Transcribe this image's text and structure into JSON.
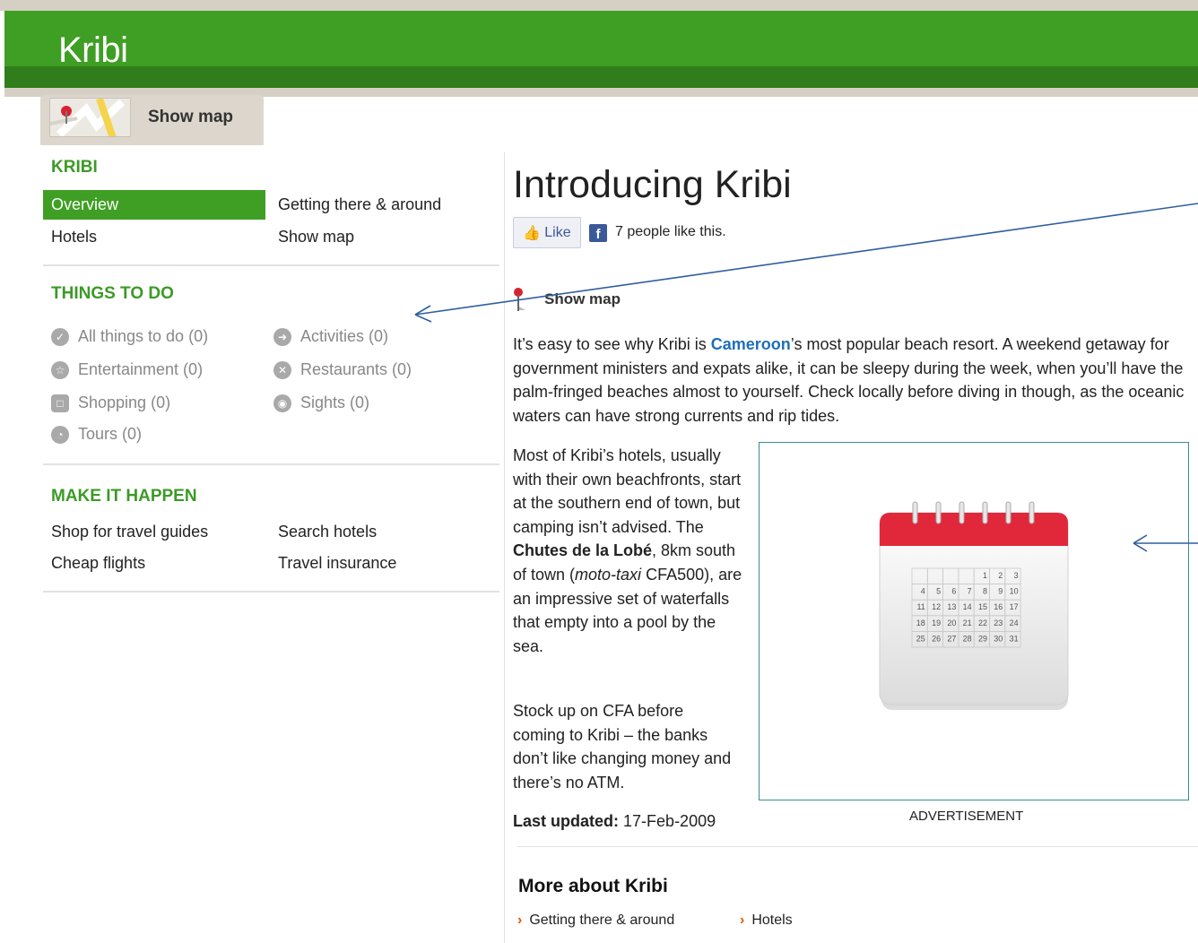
{
  "header": {
    "title": "Kribi"
  },
  "map_tab": {
    "label": "Show map"
  },
  "sidebar": {
    "kribi": {
      "title": "KRIBI",
      "items": [
        "Overview",
        "Getting there & around",
        "Hotels",
        "Show map"
      ]
    },
    "things_to_do": {
      "title": "THINGS TO DO",
      "items": [
        {
          "label": "All things to do (0)",
          "icon": "check-icon"
        },
        {
          "label": "Activities (0)",
          "icon": "activity-icon"
        },
        {
          "label": "Entertainment (0)",
          "icon": "star-icon"
        },
        {
          "label": "Restaurants (0)",
          "icon": "cutlery-icon"
        },
        {
          "label": "Shopping (0)",
          "icon": "bag-icon"
        },
        {
          "label": "Sights (0)",
          "icon": "eye-icon"
        },
        {
          "label": "Tours (0)",
          "icon": "tour-icon"
        }
      ]
    },
    "make_it_happen": {
      "title": "MAKE IT HAPPEN",
      "items": [
        "Shop for travel guides",
        "Search hotels",
        "Cheap flights",
        "Travel insurance"
      ]
    }
  },
  "main": {
    "title": "Introducing Kribi",
    "like_label": "Like",
    "like_count_text": "7 people like this.",
    "show_map_label": "Show map",
    "para1_before": "It’s easy to see why Kribi is ",
    "para1_link": "Cameroon",
    "para1_after": "’s most popular beach resort. A weekend getaway for government ministers and expats alike, it can be sleepy during the week, when you’ll have the palm-fringed beaches almost to yourself. Check locally before diving in though, as the oceanic waters can have strong currents and rip tides.",
    "para2_a": "Most of Kribi’s hotels, usually with their own beachfronts, start at the southern end of town, but camping isn’t advised. The ",
    "para2_bold": "Chutes de la Lobé",
    "para2_b": ", 8km south of town (",
    "para2_italic": "moto-taxi",
    "para2_c": " CFA500), are an impressive set of waterfalls that empty into a pool by the sea.",
    "para3": "Stock up on CFA before coming to Kribi – the banks don’t like changing money and there’s no ATM.",
    "last_updated_label": "Last updated:",
    "last_updated_value": "17-Feb-2009",
    "ad_label": "ADVERTISEMENT",
    "calendar_days": [
      "1",
      "2",
      "3",
      "4",
      "5",
      "6",
      "7",
      "8",
      "9",
      "10",
      "11",
      "12",
      "13",
      "14",
      "15",
      "16",
      "17",
      "18",
      "19",
      "20",
      "21",
      "22",
      "23",
      "24",
      "25",
      "26",
      "27",
      "28",
      "29",
      "30",
      "31"
    ],
    "more_title": "More about Kribi",
    "more_links": [
      "Getting there & around",
      "Hotels"
    ]
  },
  "colors": {
    "brand_green": "#3f9f24",
    "dark_green": "#2f7d1b",
    "link_blue": "#1f6fb8",
    "calendar_red": "#e0283a",
    "arrow_blue": "#2f5f9e"
  }
}
